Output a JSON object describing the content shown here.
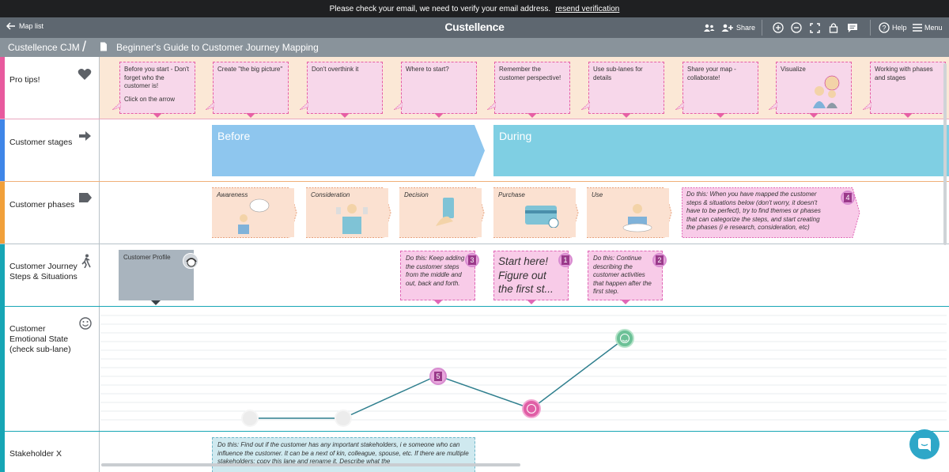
{
  "notice": {
    "text": "Please check your email, we need to verify your email address.",
    "link": "resend verification"
  },
  "topbar": {
    "back_label": "Map list",
    "brand": "Custellence",
    "share_label": "Share",
    "help_label": "Help",
    "menu_label": "Menu"
  },
  "breadcrumb": {
    "workspace": "Custellence CJM",
    "map_title": "Beginner's Guide to Customer Journey Mapping"
  },
  "lanes": {
    "pro_tips": {
      "label": "Pro tips!",
      "color": "#e85a9e"
    },
    "stages": {
      "label": "Customer stages",
      "color": "#3f86e8"
    },
    "phases": {
      "label": "Customer phases",
      "color": "#f1a03a"
    },
    "steps": {
      "label": "Customer Journey Steps & Situations",
      "color": "#17a6b5"
    },
    "emotion": {
      "label": "Customer Emotional State (check sub-lane)",
      "color": "#17a6b5"
    },
    "stakeholder": {
      "label": "Stakeholder X",
      "color": "#17a6b5"
    }
  },
  "tips": [
    {
      "text": "Before you start - Don't forget who the customer is!",
      "text2": "Click on the arrow"
    },
    {
      "text": "Create \"the big picture\""
    },
    {
      "text": "Don't overthink it"
    },
    {
      "text": "Where to start?"
    },
    {
      "text": "Remember the customer perspective!"
    },
    {
      "text": "Use sub-lanes for details"
    },
    {
      "text": "Share your map - collaborate!"
    },
    {
      "text": "Visualize"
    },
    {
      "text": "Working with phases and stages"
    }
  ],
  "stages": [
    {
      "label": "Before",
      "color": "#8ec6ee"
    },
    {
      "label": "During",
      "color": "#7fcfe3"
    }
  ],
  "phases": [
    {
      "label": "Awareness"
    },
    {
      "label": "Consideration"
    },
    {
      "label": "Decision"
    },
    {
      "label": "Purchase"
    },
    {
      "label": "Use"
    }
  ],
  "phase_note": {
    "text": "Do this: When you have mapped the customer steps & situations below (don't worry, it doesn't have to be perfect), try to find themes or phases that can categorize the steps, and start creating the phases (i e research, consideration, etc)",
    "badge": "4"
  },
  "steps": {
    "profile_label": "Customer Profile",
    "note3": {
      "text": "Do this: Keep adding the customer steps from the middle and out, back and forth.",
      "badge": "3"
    },
    "start": {
      "text": "Start here! Figure out the first st...",
      "badge": "1"
    },
    "note2": {
      "text": "Do this: Continue describing the customer activities that happen after the first step.",
      "badge": "2"
    }
  },
  "emotion": {
    "marker_badge": "5"
  },
  "stakeholder_note": {
    "text": "Do this: Find out if the customer has any important stakeholders, i e someone who can influence the customer. It can be a next of kin, colleague, spouse, etc. If there are multiple stakeholders: copy this lane and rename it. Describe what the"
  }
}
